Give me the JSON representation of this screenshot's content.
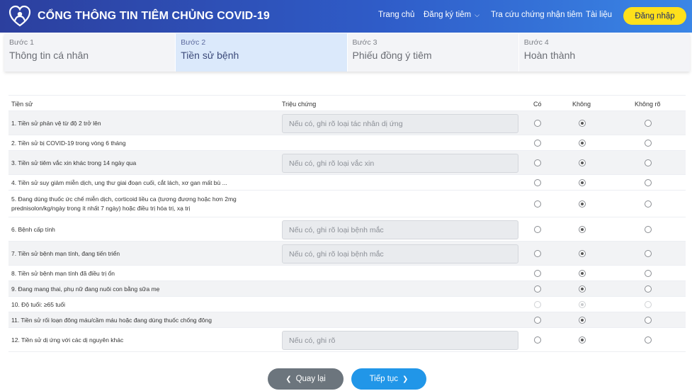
{
  "header": {
    "title": "CỔNG THÔNG TIN TIÊM CHỦNG COVID-19",
    "nav": [
      {
        "label": "Trang chủ"
      },
      {
        "label": "Đăng ký tiêm"
      },
      {
        "label": "Tra cứu chứng nhận tiêm"
      },
      {
        "label": "Tài liệu"
      }
    ],
    "login_label": "Đăng nhập",
    "colors": {
      "header_start": "#2c3f9e",
      "header_end": "#3a86e6",
      "login_bg": "#ffe01b"
    }
  },
  "steps": [
    {
      "num": "Bước 1",
      "label": "Thông tin cá nhân",
      "active": false
    },
    {
      "num": "Bước 2",
      "label": "Tiền sử bệnh",
      "active": true
    },
    {
      "num": "Bước 3",
      "label": "Phiếu đồng ý tiêm",
      "active": false
    },
    {
      "num": "Bước 4",
      "label": "Hoàn thành",
      "active": false
    }
  ],
  "table": {
    "columns": {
      "history": "Tiền sử",
      "symptom": "Triệu chứng",
      "yes": "Có",
      "no": "Không",
      "unknown": "Không rõ"
    },
    "rows": [
      {
        "label": "1. Tiền sử phản vệ từ độ 2 trở lên",
        "placeholder": "Nếu có, ghi rõ loại tác nhân dị ứng",
        "answer": "no"
      },
      {
        "label": "2. Tiền sử bị COVID-19 trong vòng 6 tháng",
        "placeholder": null,
        "answer": "no"
      },
      {
        "label": "3. Tiền sử tiêm vắc xin khác trong 14 ngày qua",
        "placeholder": "Nếu có, ghi rõ loại vắc xin",
        "answer": "no"
      },
      {
        "label": "4. Tiền sử suy giảm miễn dịch, ung thư giai đoạn cuối, cắt lách, xơ gan mất bù ...",
        "placeholder": null,
        "answer": "no"
      },
      {
        "label": "5. Đang dùng thuốc ức chế miễn dịch, corticoid liều ca (tương đương hoặc hơn 2mg prednisolon/kg/ngày trong ít nhất 7 ngày) hoặc điều trị hóa trị, xạ trị",
        "placeholder": null,
        "answer": "no"
      },
      {
        "label": "6. Bệnh cấp tính",
        "placeholder": "Nếu có, ghi rõ loại bệnh mắc",
        "answer": "no"
      },
      {
        "label": "7. Tiền sử bệnh mạn tính, đang tiến triển",
        "placeholder": "Nếu có, ghi rõ loại bệnh mắc",
        "answer": "no"
      },
      {
        "label": "8. Tiền sử bệnh mạn tính đã điều trị ổn",
        "placeholder": null,
        "answer": "no"
      },
      {
        "label": "9. Đang mang thai, phụ nữ đang nuôi con bằng sữa mẹ",
        "placeholder": null,
        "answer": "no"
      },
      {
        "label": "10. Độ tuổi: ≥65 tuổi",
        "placeholder": null,
        "answer": "no",
        "disabled": true
      },
      {
        "label": "11. Tiền sử rối loạn đông máu/cầm máu hoặc đang dùng thuốc chống đông",
        "placeholder": null,
        "answer": "no"
      },
      {
        "label": "12. Tiền sử dị ứng với các dị nguyên khác",
        "placeholder": "Nếu có, ghi rõ",
        "answer": "no"
      }
    ]
  },
  "buttons": {
    "back": "Quay lại",
    "next": "Tiếp tục"
  }
}
